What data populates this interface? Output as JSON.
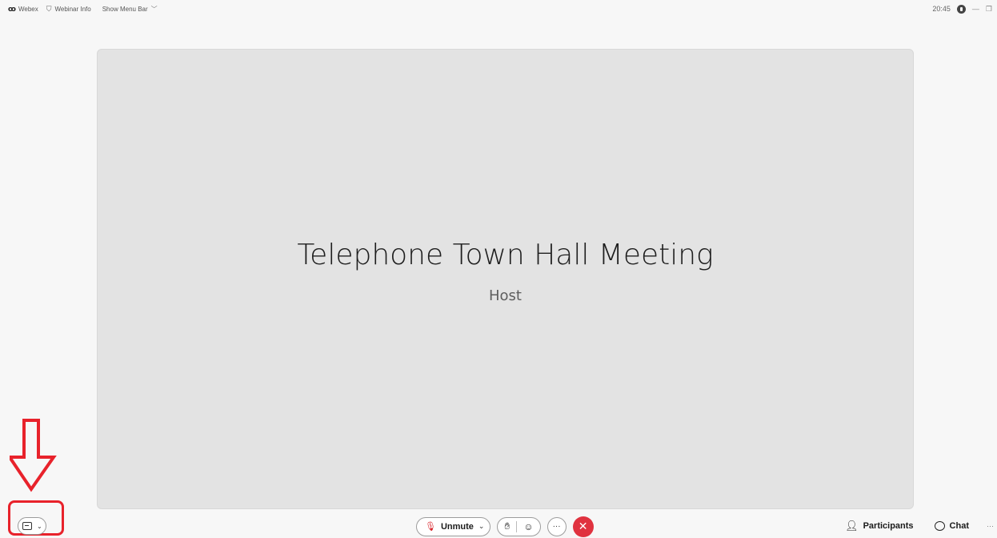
{
  "titlebar": {
    "app_name": "Webex",
    "logo_glyph": "ꝏ",
    "webinar_info": "Webinar Info",
    "menu_bar_label": "Show Menu Bar",
    "time": "20:45"
  },
  "stage": {
    "title": "Telephone Town Hall Meeting",
    "role": "Host"
  },
  "controls": {
    "unmute_label": "Unmute",
    "more_glyph": "···",
    "leave_glyph": "✕"
  },
  "right_controls": {
    "participants_label": "Participants",
    "chat_label": "Chat",
    "more_glyph": "···"
  },
  "icons": {
    "mic_muted": "mic-muted-icon",
    "hand": "raise-hand-icon",
    "reactions": "reactions-icon",
    "caption": "closed-caption-icon"
  },
  "colors": {
    "leave": "#e0323f",
    "annotation": "#e8222b",
    "stage_bg": "#e3e3e3"
  }
}
